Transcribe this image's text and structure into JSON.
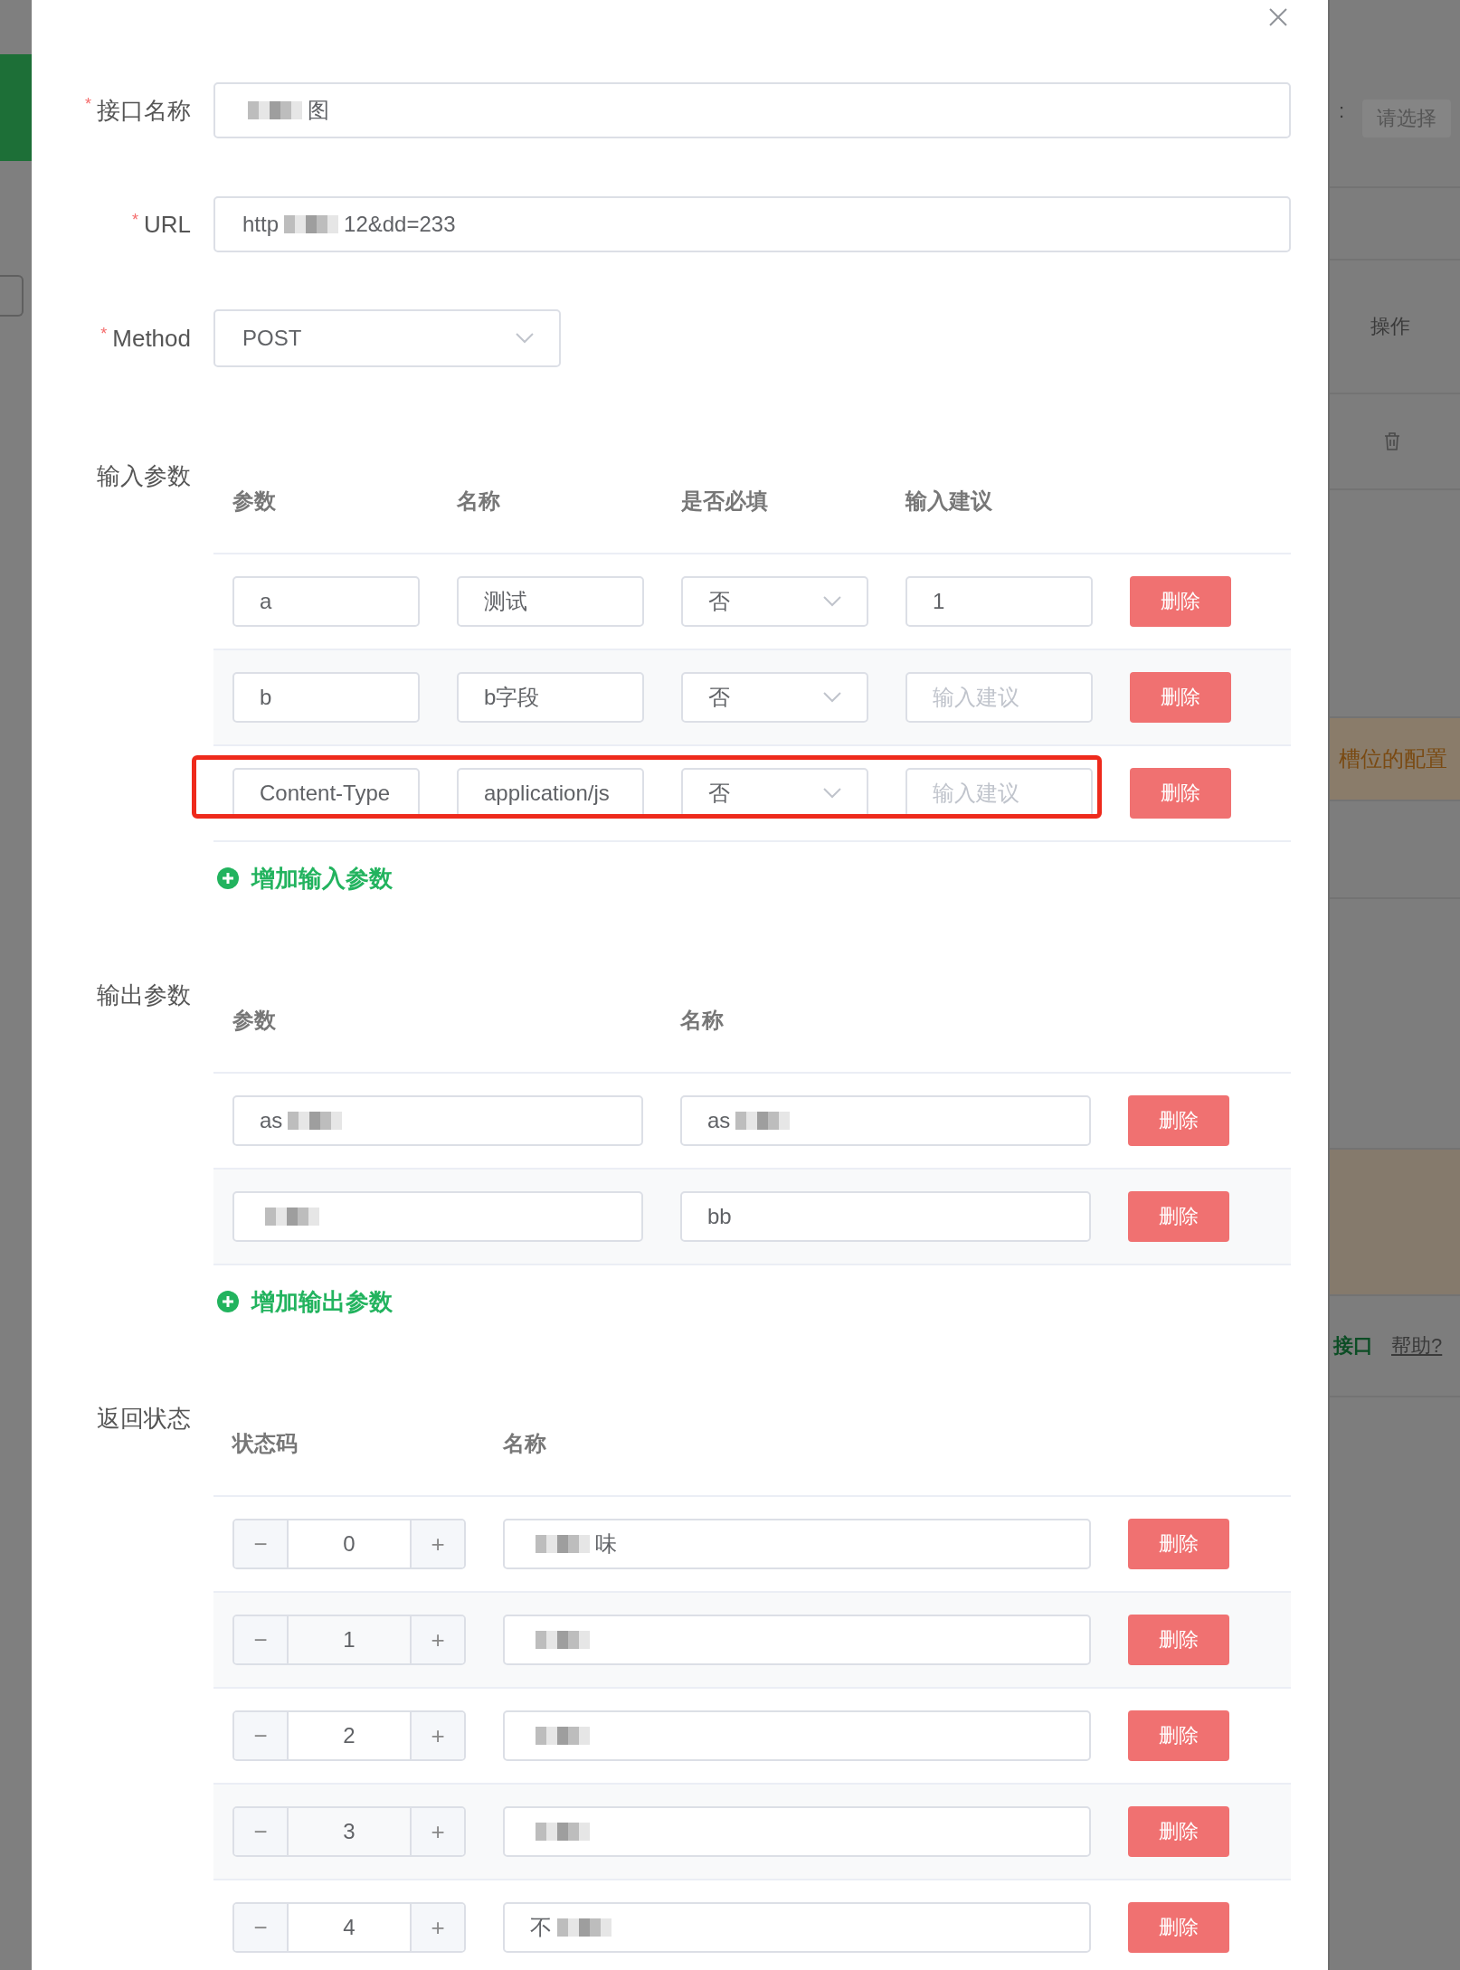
{
  "background": {
    "filter_placeholder": "请选择",
    "filter_label_tail": ":",
    "column_header": "操作",
    "notice": "槽位的配置",
    "link": "接口",
    "help_link": "帮助?"
  },
  "dialog": {
    "fields": [
      {
        "kind": "text",
        "label": "接口名称",
        "required_mark": "*",
        "segments": [
          {
            "kind": "redacted"
          },
          {
            "kind": "text",
            "text": "图"
          }
        ]
      },
      {
        "kind": "text",
        "label": "URL",
        "required_mark": "*",
        "segments": [
          {
            "kind": "text",
            "text": "http"
          },
          {
            "kind": "redacted"
          },
          {
            "kind": "text",
            "text": "12&dd=233"
          }
        ]
      },
      {
        "kind": "select",
        "label": "Method",
        "required_mark": "*",
        "value": "POST"
      }
    ],
    "input_params": {
      "label": "输入参数",
      "columns": [
        "参数",
        "名称",
        "是否必填",
        "输入建议"
      ],
      "rows": [
        {
          "param": "a",
          "name": "测试",
          "required_value": "否",
          "suggestion": {
            "value": "1"
          },
          "highlighted": false,
          "delete": "删除"
        },
        {
          "param": "b",
          "name": "b字段",
          "required_value": "否",
          "suggestion": {
            "placeholder": "输入建议"
          },
          "highlighted": false,
          "delete": "删除"
        },
        {
          "param": "Content-Type",
          "name": "application/js",
          "required_value": "否",
          "suggestion": {
            "placeholder": "输入建议"
          },
          "highlighted": true,
          "delete": "删除"
        }
      ],
      "add": "增加输入参数"
    },
    "output_params": {
      "label": "输出参数",
      "columns": [
        "参数",
        "名称"
      ],
      "rows": [
        {
          "param": [
            {
              "kind": "text",
              "text": "as"
            },
            {
              "kind": "redacted"
            }
          ],
          "name": [
            {
              "kind": "text",
              "text": "as"
            },
            {
              "kind": "redacted"
            }
          ],
          "delete": "删除"
        },
        {
          "param": [
            {
              "kind": "redacted"
            }
          ],
          "name": [
            {
              "kind": "text",
              "text": "bb"
            }
          ],
          "delete": "删除"
        }
      ],
      "add": "增加输出参数"
    },
    "return_status": {
      "label": "返回状态",
      "columns": [
        "状态码",
        "名称"
      ],
      "rows": [
        {
          "minus": "−",
          "code": "0",
          "plus": "+",
          "name": [
            {
              "kind": "redacted"
            },
            {
              "kind": "text",
              "text": "味"
            }
          ],
          "delete": "删除"
        },
        {
          "minus": "−",
          "code": "1",
          "plus": "+",
          "name": [
            {
              "kind": "redacted"
            }
          ],
          "delete": "删除"
        },
        {
          "minus": "−",
          "code": "2",
          "plus": "+",
          "name": [
            {
              "kind": "redacted"
            }
          ],
          "delete": "删除"
        },
        {
          "minus": "−",
          "code": "3",
          "plus": "+",
          "name": [
            {
              "kind": "redacted"
            }
          ],
          "delete": "删除"
        },
        {
          "minus": "−",
          "code": "4",
          "plus": "+",
          "name": [
            {
              "kind": "text",
              "text": "不"
            },
            {
              "kind": "redacted"
            }
          ],
          "delete": "删除"
        }
      ]
    }
  }
}
